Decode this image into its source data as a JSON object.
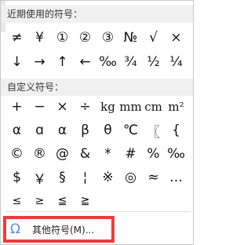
{
  "recent_section": {
    "title": "近期使用的符号：",
    "symbols": [
      "≠",
      "¥",
      "①",
      "②",
      "③",
      "№",
      "√",
      "×",
      "↓",
      "→",
      "↑",
      "←",
      "‰",
      "¾",
      "½",
      "¼"
    ]
  },
  "custom_section": {
    "title": "自定义符号：",
    "symbols": [
      "+",
      "−",
      "×",
      "÷",
      "kg",
      "mm",
      "cm",
      "m²",
      "α",
      "ɑ",
      "α",
      "β",
      "θ",
      "℃",
      "〖",
      "{",
      "©",
      "®",
      "@",
      "&",
      "*",
      "#",
      "%",
      "‰",
      "$",
      "￥",
      "§",
      "¦",
      "※",
      "◎",
      "≈",
      "…",
      "≤",
      "≥",
      "≦",
      "≧"
    ]
  },
  "more_symbols": {
    "icon": "omega-icon",
    "label": "其他符号(M)..."
  },
  "colors": {
    "highlight_border": "#ee3b3b",
    "omega_icon": "#5a8fcc",
    "section_bg": "#f0f0f0"
  }
}
